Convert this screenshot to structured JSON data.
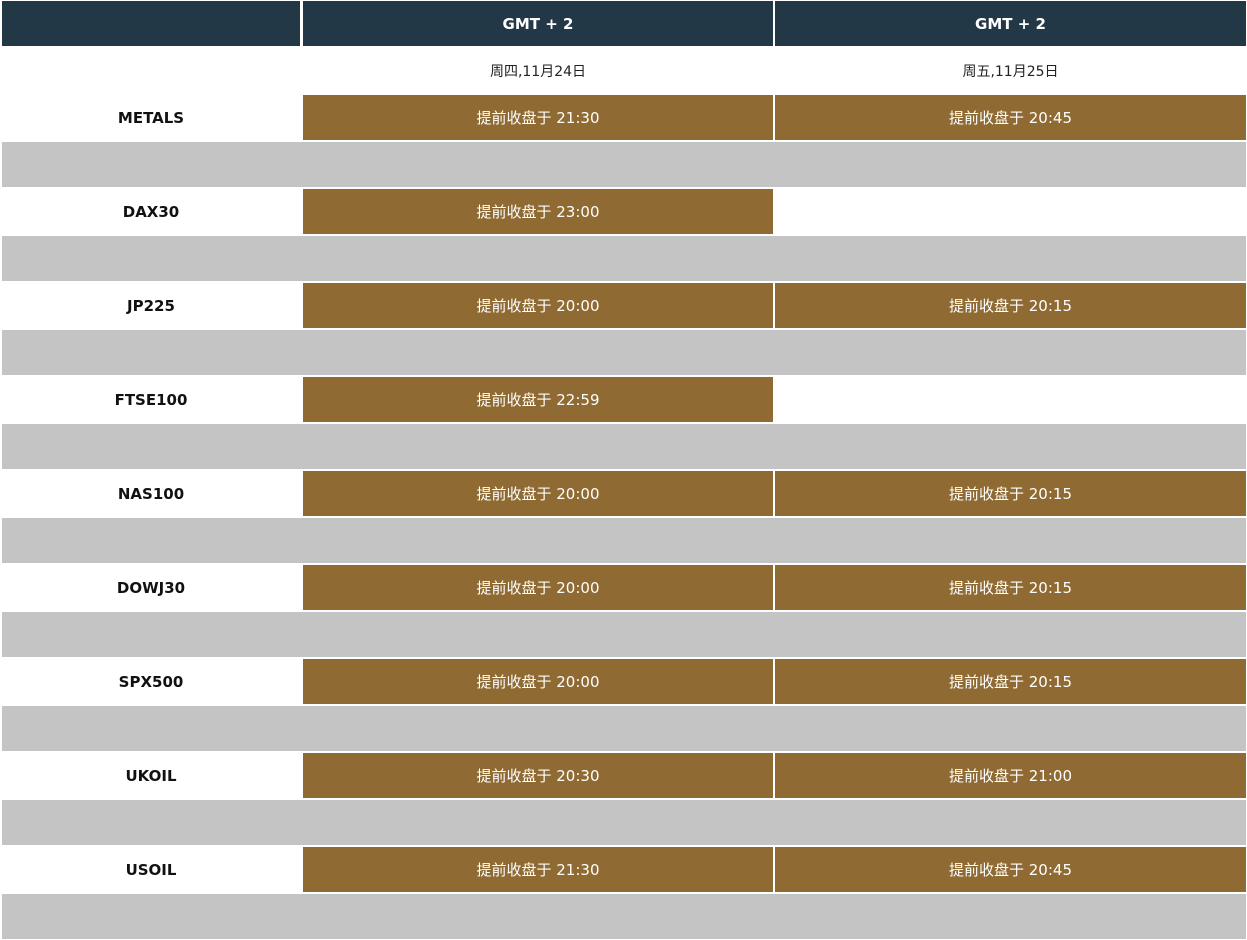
{
  "header": {
    "col0": "",
    "col1": "GMT + 2",
    "col2": "GMT + 2"
  },
  "dates": {
    "col1": "周四,11月24日",
    "col2": "周五,11月25日"
  },
  "rows": [
    {
      "instrument": "METALS",
      "day1": "提前收盘于 21:30",
      "day2": "提前收盘于 20:45"
    },
    {
      "instrument": "DAX30",
      "day1": "提前收盘于 23:00",
      "day2": ""
    },
    {
      "instrument": "JP225",
      "day1": "提前收盘于 20:00",
      "day2": "提前收盘于 20:15"
    },
    {
      "instrument": "FTSE100",
      "day1": "提前收盘于 22:59",
      "day2": ""
    },
    {
      "instrument": "NAS100",
      "day1": "提前收盘于 20:00",
      "day2": "提前收盘于 20:15"
    },
    {
      "instrument": "DOWJ30",
      "day1": "提前收盘于 20:00",
      "day2": "提前收盘于 20:15"
    },
    {
      "instrument": "SPX500",
      "day1": "提前收盘于 20:00",
      "day2": "提前收盘于 20:15"
    },
    {
      "instrument": "UKOIL",
      "day1": "提前收盘于 20:30",
      "day2": "提前收盘于 21:00"
    },
    {
      "instrument": "USOIL",
      "day1": "提前收盘于 21:30",
      "day2": "提前收盘于 20:45"
    }
  ],
  "colors": {
    "header_bg": "#223846",
    "slot_bg": "#8f6a32",
    "spacer_bg": "#c4c4c4"
  }
}
